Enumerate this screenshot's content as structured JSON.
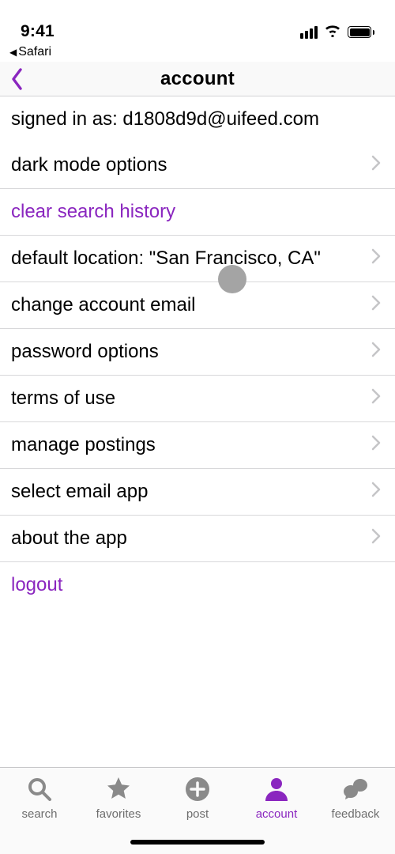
{
  "status": {
    "time": "9:41",
    "back_app": "Safari"
  },
  "nav": {
    "title": "account"
  },
  "rows": {
    "signed_in": "signed in as: d1808d9d@uifeed.com",
    "dark_mode": "dark mode options",
    "clear_history": "clear search history",
    "default_location": "default location: \"San Francisco, CA\"",
    "change_email": "change account email",
    "password": "password options",
    "terms": "terms of use",
    "manage": "manage postings",
    "email_app": "select email app",
    "about": "about the app",
    "logout": "logout"
  },
  "tabs": {
    "search": "search",
    "favorites": "favorites",
    "post": "post",
    "account": "account",
    "feedback": "feedback"
  },
  "colors": {
    "accent": "#8a26bf",
    "inactive": "#999999"
  }
}
